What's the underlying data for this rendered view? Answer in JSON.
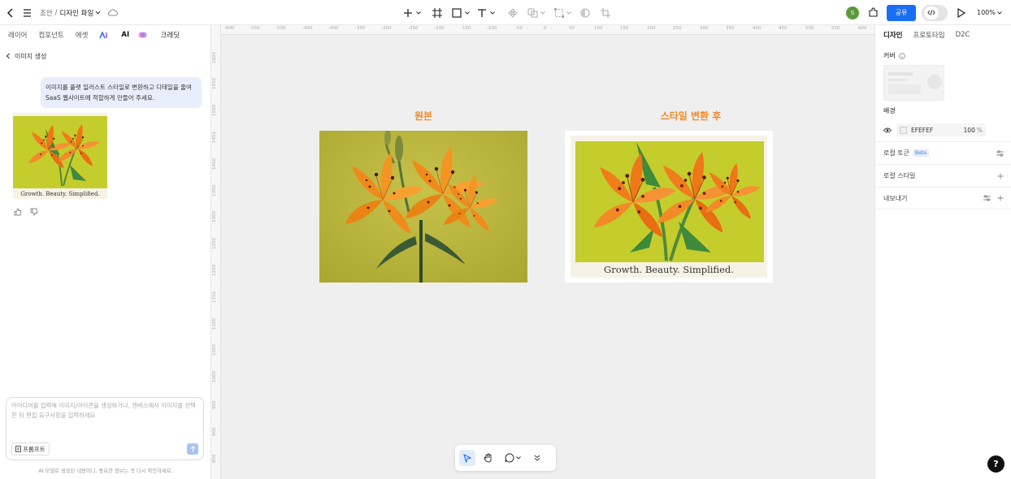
{
  "topbar": {
    "breadcrumb_user": "조안",
    "breadcrumb_sep": "/",
    "file_name": "디자인 파일",
    "avatar_initial": "S",
    "share_label": "공유",
    "zoom": "100%"
  },
  "left_panel": {
    "tabs": [
      "레이어",
      "컴포넌트",
      "에셋",
      "AI"
    ],
    "credit_label": "크레딧",
    "back_label": "이미지 생성",
    "user_message": "이미지를 플랫 일러스트 스타일로 변환하고 디테일을 줄여 SaaS 웹사이트에 적합하게 만들어 주세요.",
    "result_caption": "Growth. Beauty. Simplified.",
    "input_placeholder": "아이디어를 입력해 이미지/아이콘을 생성하거나, 캔버스에서 이미지를 선택한 뒤 편집 요구사항을 입력하세요",
    "prompt_button": "프롬프트",
    "disclaimer": "AI 모델로 생성된 내용이니, 중요한 정보는 꼭 다시 확인하세요."
  },
  "canvas": {
    "ruler_h": [
      "-600",
      "-550",
      "-500",
      "-450",
      "-400",
      "-350",
      "-300",
      "-250",
      "-200",
      "-150",
      "-100",
      "-50",
      "0",
      "50",
      "100",
      "150",
      "200",
      "250",
      "300",
      "350",
      "400",
      "450",
      "500",
      "550",
      "600"
    ],
    "ruler_v": [
      "1600",
      "1550",
      "1500",
      "1450",
      "1400",
      "1350",
      "1300",
      "1250",
      "1200",
      "1150",
      "1100",
      "1050",
      "1000",
      "950",
      "900",
      "850"
    ],
    "original_title": "원본",
    "styled_title": "스타일 변환 후",
    "styled_caption": "Growth. Beauty. Simplified."
  },
  "right_panel": {
    "tabs": [
      "디자인",
      "프로토타입",
      "D2C"
    ],
    "cover_label": "커버",
    "background_label": "배경",
    "bg_hex": "EFEFEF",
    "bg_opacity": "100",
    "bg_opacity_unit": "%",
    "local_tokens": "로컬 토큰",
    "beta_badge": "Beta",
    "local_styles": "로컬 스타일",
    "export": "내보내기"
  },
  "help_label": "?",
  "colors": {
    "accent": "#1a6ef5",
    "title_orange": "#f0892a",
    "canvas_bg": "#efefef",
    "avatar_green": "#5a9a3a"
  }
}
